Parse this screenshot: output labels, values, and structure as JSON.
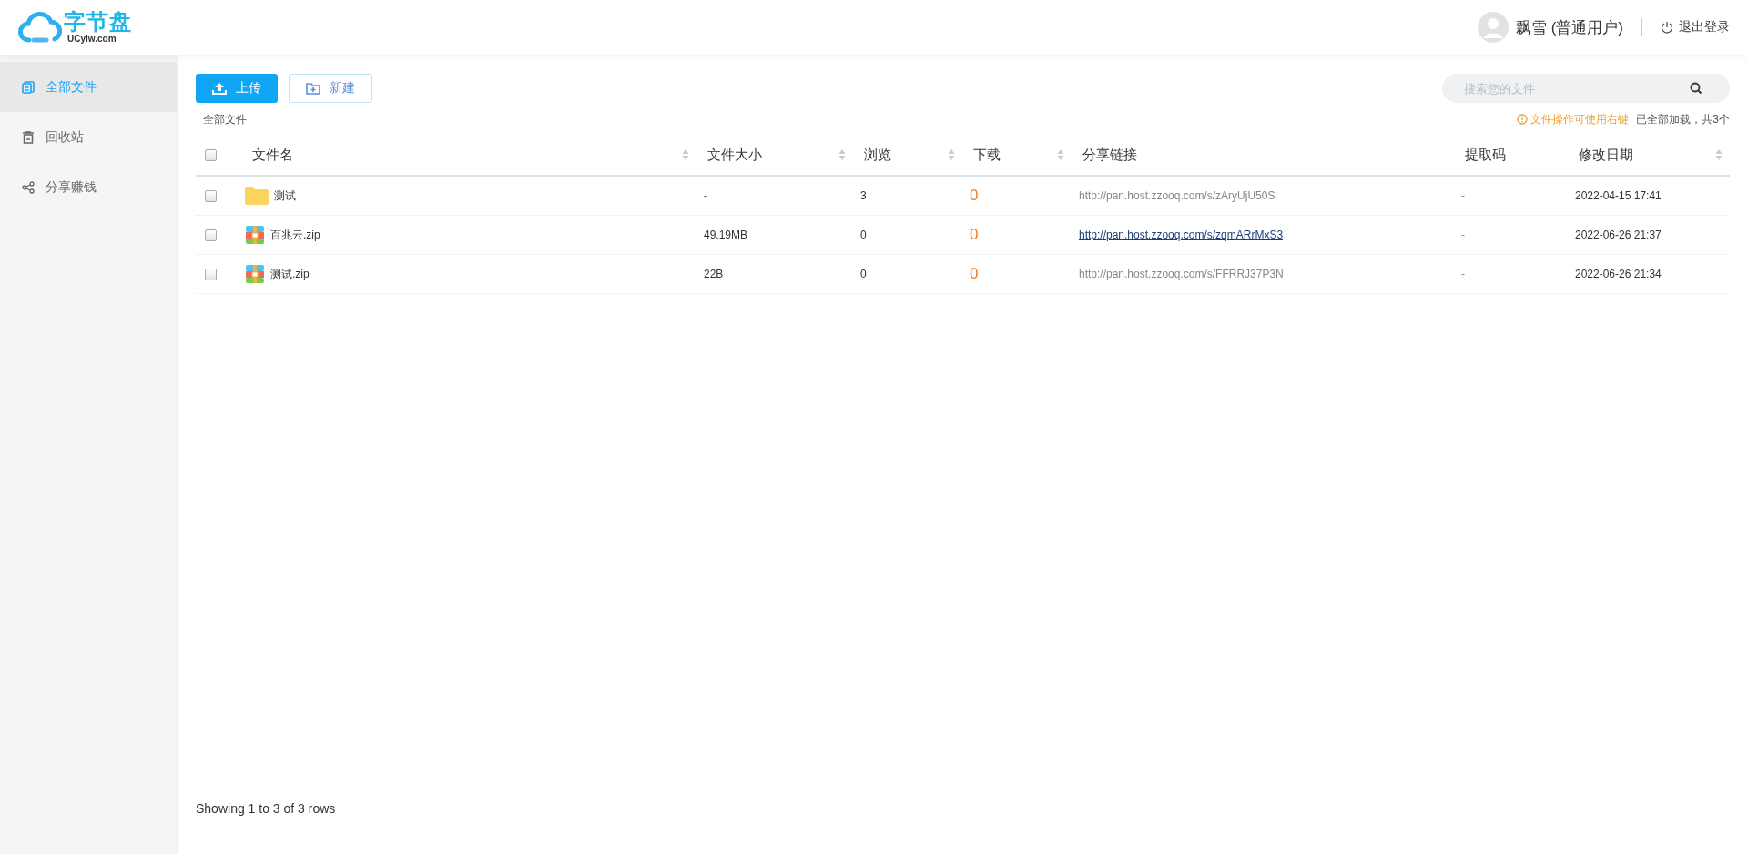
{
  "logo": {
    "title": "字节盘",
    "subtitle": "UCylw.com"
  },
  "user": {
    "name": "飘雪 (普通用户)",
    "logout": "退出登录"
  },
  "sidebar": {
    "items": [
      {
        "label": "全部文件",
        "kind": "files",
        "selected": true
      },
      {
        "label": "回收站",
        "kind": "trash",
        "selected": false
      },
      {
        "label": "分享赚钱",
        "kind": "share",
        "selected": false
      }
    ]
  },
  "toolbar": {
    "upload": "上传",
    "create": "新建",
    "search": {
      "placeholder": "搜索您的文件"
    }
  },
  "breadcrumb": "全部文件",
  "notice": {
    "tip": "文件操作可使用右键",
    "status": "已全部加载，共3个"
  },
  "table": {
    "all_checked": false,
    "columns": [
      {
        "label": "文件名",
        "sortable": true
      },
      {
        "label": "文件大小",
        "sortable": true
      },
      {
        "label": "浏览",
        "sortable": true
      },
      {
        "label": "下载",
        "sortable": true
      },
      {
        "label": "分享链接",
        "sortable": false
      },
      {
        "label": "提取码",
        "sortable": false
      },
      {
        "label": "修改日期",
        "sortable": true
      }
    ],
    "rows": [
      {
        "checked": false,
        "kind": "folder",
        "name": "测试",
        "size": "-",
        "views": "3",
        "downloads": "0",
        "link": "http://pan.host.zzooq.com/s/zAryUjU50S",
        "link_hovered": false,
        "code": "-",
        "date": "2022-04-15 17:41"
      },
      {
        "checked": false,
        "kind": "zip",
        "name": "百兆云.zip",
        "size": "49.19MB",
        "views": "0",
        "downloads": "0",
        "link": "http://pan.host.zzooq.com/s/zqmARrMxS3",
        "link_hovered": true,
        "code": "-",
        "date": "2022-06-26 21:37"
      },
      {
        "checked": false,
        "kind": "zip",
        "name": "测试.zip",
        "size": "22B",
        "views": "0",
        "downloads": "0",
        "link": "http://pan.host.zzooq.com/s/FFRRJ37P3N",
        "link_hovered": false,
        "code": "-",
        "date": "2022-06-26 21:34"
      }
    ]
  },
  "footer": "Showing 1 to 3 of 3 rows"
}
